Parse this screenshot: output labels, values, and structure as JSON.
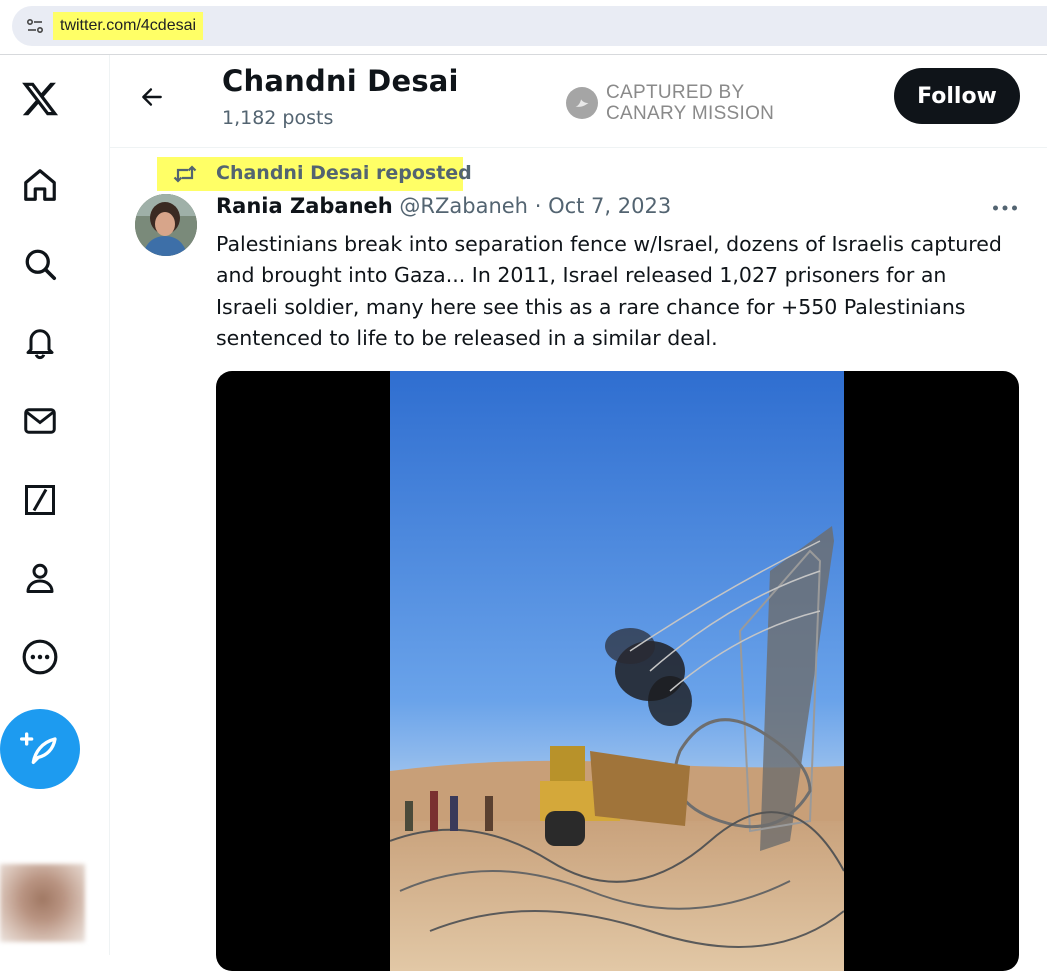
{
  "browser": {
    "url": "twitter.com/4cdesai"
  },
  "header": {
    "profile_name": "Chandni Desai",
    "post_count": "1,182 posts",
    "follow_label": "Follow"
  },
  "watermark": {
    "line1": "CAPTURED BY",
    "line2": "CANARY MISSION"
  },
  "nav": {
    "items": [
      "x-logo-icon",
      "home-icon",
      "search-icon",
      "bell-icon",
      "mail-icon",
      "grok-icon",
      "profile-icon",
      "more-icon",
      "compose-icon"
    ]
  },
  "post": {
    "repost_label": "Chandni Desai reposted",
    "author_name": "Rania Zabaneh",
    "author_handle": "@RZabaneh",
    "separator": "·",
    "date": "Oct 7, 2023",
    "text": "Palestinians break into separation fence w/Israel, dozens of Israelis captured and brought into Gaza... In 2011, Israel released 1,027 prisoners for an Israeli soldier, many here see this as a rare chance for +550 Palestinians sentenced to life to be released in a similar deal."
  },
  "colors": {
    "accent": "#1d9bf0",
    "text_primary": "#0f1419",
    "text_secondary": "#536471",
    "highlight": "#ffff66"
  }
}
